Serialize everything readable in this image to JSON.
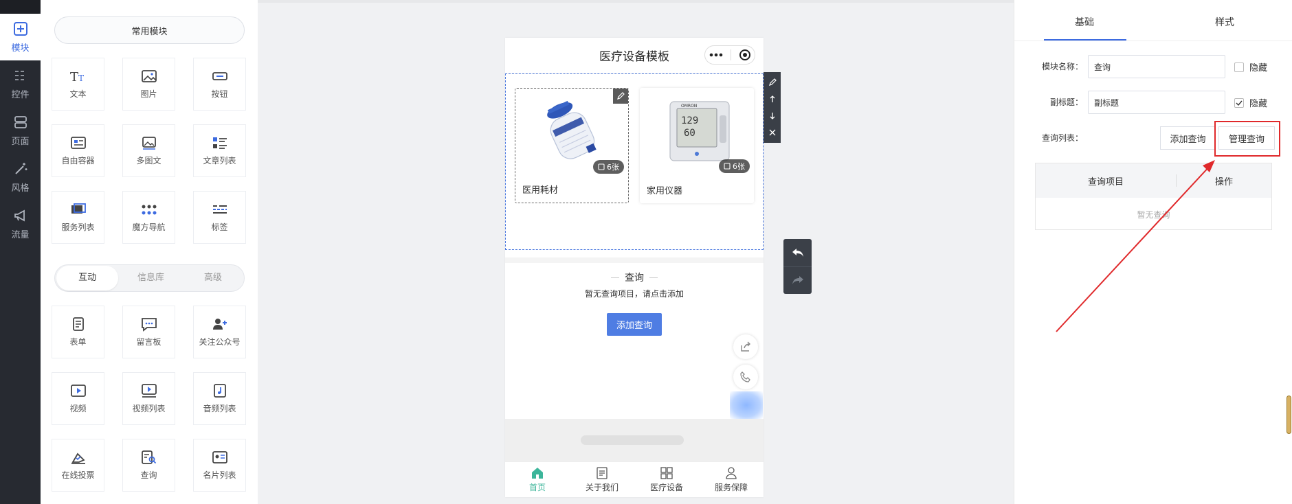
{
  "rail": {
    "items": [
      {
        "label": "模块",
        "icon": "plus-square-icon",
        "active": true
      },
      {
        "label": "控件",
        "icon": "sliders-icon"
      },
      {
        "label": "页面",
        "icon": "pages-icon"
      },
      {
        "label": "风格",
        "icon": "magic-wand-icon"
      },
      {
        "label": "流量",
        "icon": "megaphone-icon"
      }
    ]
  },
  "modules": {
    "common_label": "常用模块",
    "common_tiles": [
      {
        "label": "文本",
        "icon": "text-icon"
      },
      {
        "label": "图片",
        "icon": "image-icon"
      },
      {
        "label": "按钮",
        "icon": "button-icon"
      },
      {
        "label": "自由容器",
        "icon": "container-icon"
      },
      {
        "label": "多图文",
        "icon": "multi-image-icon"
      },
      {
        "label": "文章列表",
        "icon": "article-list-icon"
      },
      {
        "label": "服务列表",
        "icon": "service-list-icon"
      },
      {
        "label": "魔方导航",
        "icon": "dots-grid-icon"
      },
      {
        "label": "标签",
        "icon": "tag-icon"
      }
    ],
    "tabs": [
      "互动",
      "信息库",
      "高级"
    ],
    "interact_tiles": [
      {
        "label": "表单",
        "icon": "form-icon"
      },
      {
        "label": "留言板",
        "icon": "message-board-icon"
      },
      {
        "label": "关注公众号",
        "icon": "follow-user-icon"
      },
      {
        "label": "视频",
        "icon": "video-icon"
      },
      {
        "label": "视频列表",
        "icon": "video-list-icon"
      },
      {
        "label": "音频列表",
        "icon": "audio-list-icon"
      },
      {
        "label": "在线投票",
        "icon": "vote-icon"
      },
      {
        "label": "查询",
        "icon": "query-icon"
      },
      {
        "label": "名片列表",
        "icon": "card-list-icon"
      }
    ]
  },
  "phone": {
    "title": "医疗设备模板",
    "cards": [
      {
        "name": "医用耗材",
        "badge": "6张"
      },
      {
        "name": "家用仪器",
        "badge": "6张"
      }
    ],
    "section_title": "查询",
    "empty_tip": "暂无查询项目，请点击添加",
    "add_button": "添加查询",
    "tabs": [
      {
        "label": "首页",
        "icon": "home-icon"
      },
      {
        "label": "关于我们",
        "icon": "document-icon"
      },
      {
        "label": "医疗设备",
        "icon": "grid-icon"
      },
      {
        "label": "服务保障",
        "icon": "user-icon"
      }
    ]
  },
  "props": {
    "tabs": [
      "基础",
      "样式"
    ],
    "module_name_label": "模块名称：",
    "module_name_value": "查询",
    "subtitle_label": "副标题：",
    "subtitle_value": "副标题",
    "hide_label": "隐藏",
    "hide1_checked": false,
    "hide2_checked": true,
    "query_list_label": "查询列表：",
    "add_query_button": "添加查询",
    "manage_query_button": "管理查询",
    "table_headers": [
      "查询项目",
      "操作"
    ],
    "table_empty": "暂无查询"
  },
  "colors": {
    "accent": "#3d6be0",
    "highlight": "#e0292b",
    "tab_active": "#3cb59a"
  }
}
